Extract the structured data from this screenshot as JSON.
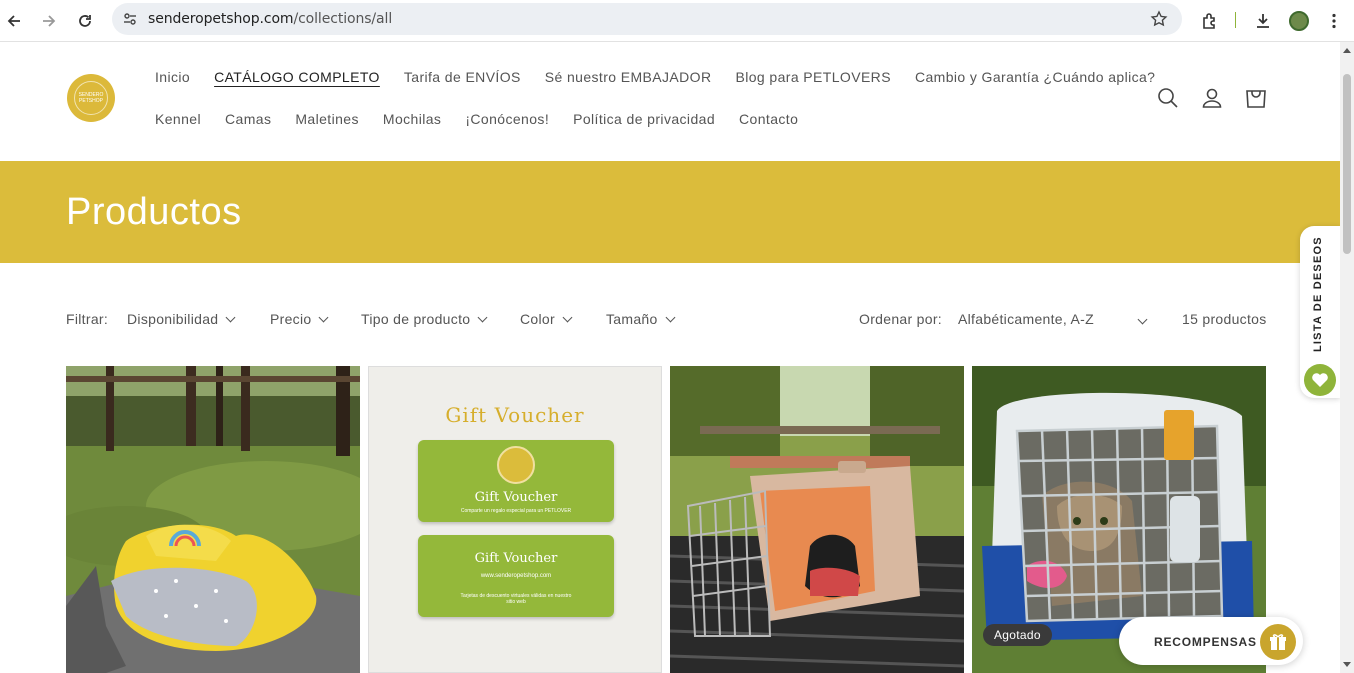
{
  "browser": {
    "url_host": "senderopetshop.com",
    "url_path": "/collections/all"
  },
  "header": {
    "logo_text": "SENDERO PETSHOP",
    "menu_row1": [
      "Inicio",
      "CATÁLOGO COMPLETO",
      "Tarifa de ENVÍOS",
      "Sé nuestro EMBAJADOR",
      "Blog para PETLOVERS",
      "Cambio y Garantía ¿Cuándo aplica?"
    ],
    "menu_row2": [
      "Kennel",
      "Camas",
      "Maletines",
      "Mochilas",
      "¡Conócenos!",
      "Política de privacidad",
      "Contacto"
    ],
    "active_item": "CATÁLOGO COMPLETO"
  },
  "banner": {
    "title": "Productos",
    "color": "#dbbc3b"
  },
  "filters": {
    "label": "Filtrar:",
    "options": [
      "Disponibilidad",
      "Precio",
      "Tipo de producto",
      "Color",
      "Tamaño"
    ],
    "sort_label": "Ordenar por:",
    "sort_value": "Alfabéticamente, A-Z",
    "count": "15 productos"
  },
  "products": [
    {
      "image": "yellow-pet-bed-photo",
      "badge": ""
    },
    {
      "image": "gift-voucher-graphic",
      "badge": ""
    },
    {
      "image": "pet-carrier-with-puppy-photo",
      "badge": ""
    },
    {
      "image": "cat-in-blue-carrier-photo",
      "badge": "Agotado"
    }
  ],
  "voucher": {
    "heading": "Gift Voucher",
    "card1_title": "Gift Voucher",
    "card1_text": "Comparte un regalo especial para un PETLOVER",
    "card2_title": "Gift Voucher",
    "card2_url": "www.senderopetshop.com",
    "card2_text": "Tarjetas de descuento virtuales válidas en nuestro sitio web"
  },
  "wishlist": {
    "label": "LISTA DE DESEOS"
  },
  "rewards": {
    "label": "RECOMPENSAS"
  },
  "colors": {
    "accent_yellow": "#dbbc3b",
    "accent_green": "#8fb43a"
  }
}
